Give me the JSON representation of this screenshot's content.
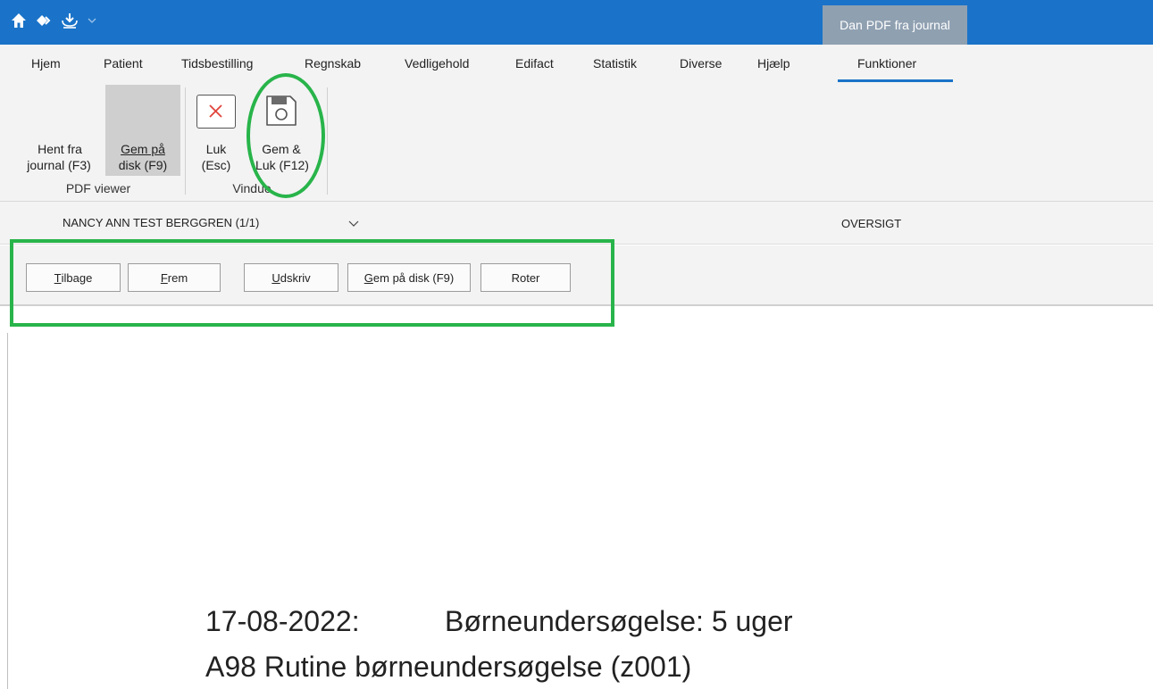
{
  "titlebar": {
    "context_tab": "Dan PDF fra journal",
    "icons": [
      "home-icon",
      "nav-diamond-icon",
      "download-icon",
      "chevron-down-icon"
    ]
  },
  "menu": {
    "items": [
      "Hjem",
      "Patient",
      "Tidsbestilling",
      "Regnskab",
      "Vedligehold",
      "Edifact",
      "Statistik",
      "Diverse",
      "Hjælp",
      "Funktioner"
    ],
    "active": "Funktioner"
  },
  "ribbon": {
    "hent_line1": "Hent fra",
    "hent_line2": "journal (F3)",
    "gem_line1": "Gem på",
    "gem_line2": "disk (F9)",
    "group_pdf_viewer": "PDF viewer",
    "luk_line1": "Luk",
    "luk_line2": "(Esc)",
    "gemluk_line1": "Gem &",
    "gemluk_line2": "Luk (F12)",
    "group_vindue": "Vindue"
  },
  "patient": {
    "name": "NANCY ANN TEST BERGGREN (1/1)",
    "overview": "OVERSIGT"
  },
  "toolbar": {
    "tilbage_u": "T",
    "tilbage_rest": "ilbage",
    "frem_u": "F",
    "frem_rest": "rem",
    "udskriv_u": "U",
    "udskriv_rest": "dskriv",
    "gem_u": "G",
    "gem_rest": "em på disk (F9)",
    "roter": "Roter"
  },
  "document": {
    "date": "17-08-2022:",
    "title": "Børneundersøgelse: 5 uger",
    "line2": "A98 Rutine børneundersøgelse (z001)"
  },
  "colors": {
    "accent": "#1a73c8",
    "annotation": "#28b44a",
    "context_tab": "#8fa0b1"
  }
}
